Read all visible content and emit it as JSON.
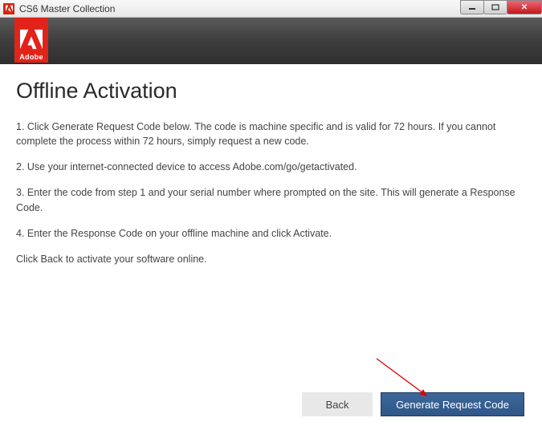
{
  "titlebar": {
    "title": "CS6 Master Collection"
  },
  "brand": {
    "name": "Adobe"
  },
  "page": {
    "title": "Offline Activation",
    "step1": "1. Click Generate Request Code below. The code is machine specific and is valid for 72 hours. If you cannot complete the process within 72 hours, simply request a new code.",
    "step2": "2. Use your internet-connected device to access Adobe.com/go/getactivated.",
    "step3": "3. Enter the code from step 1 and your serial number where prompted on the site. This will generate a Response Code.",
    "step4": "4. Enter the Response Code on your offline machine and click Activate.",
    "note": "Click Back to activate your software online."
  },
  "buttons": {
    "back": "Back",
    "generate": "Generate Request Code"
  }
}
